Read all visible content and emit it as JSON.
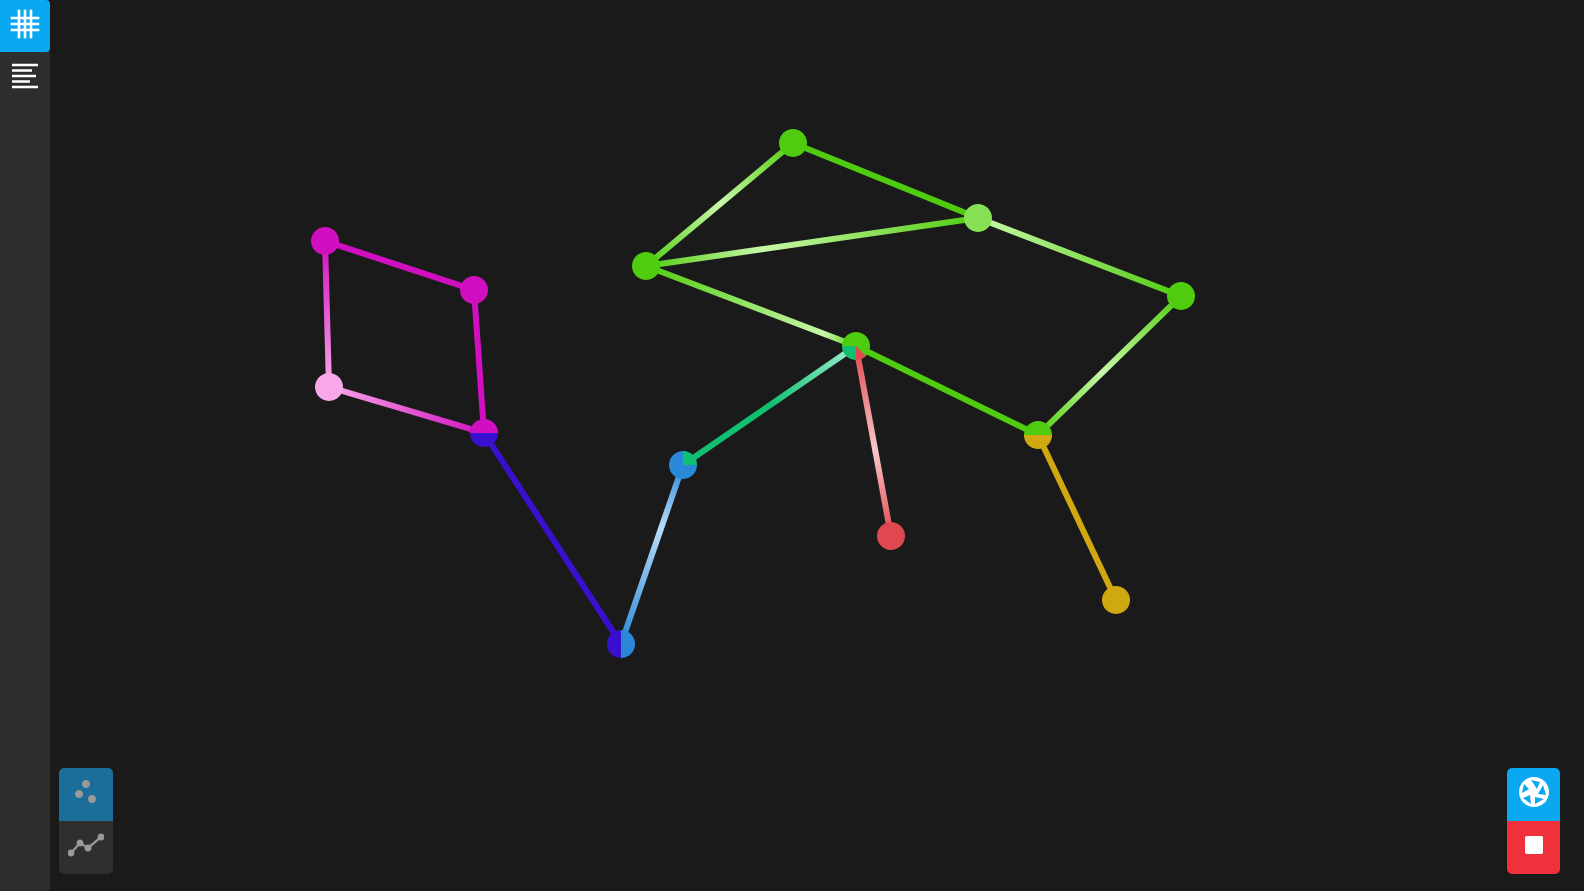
{
  "sidebar": {
    "items": [
      {
        "icon": "grid-icon",
        "active": true
      },
      {
        "icon": "align-left-icon",
        "active": false
      }
    ],
    "accent_color": "#0ba8f2"
  },
  "graph": {
    "skeletons": [
      {
        "color": "#d010c0",
        "light_color": "#f8a8e8"
      },
      {
        "color": "#3a10d0",
        "light_color": "#7a60f0"
      },
      {
        "color": "#2a88d8",
        "light_color": "#b8dcf8"
      },
      {
        "color": "#10c070",
        "light_color": "#a0f0d0"
      },
      {
        "color": "#50cc10",
        "light_color": "#c8f8a8"
      },
      {
        "color": "#e04850",
        "light_color": "#f8c8c8"
      },
      {
        "color": "#d0a810",
        "light_color": "#f0d870"
      }
    ]
  },
  "mode_toggle": {
    "items": [
      {
        "icon": "points-icon",
        "active": true
      },
      {
        "icon": "line-chart-icon",
        "active": false
      }
    ]
  },
  "capture": {
    "shutter_icon": "camera-shutter-icon",
    "stop_icon": "stop-icon",
    "shutter_color": "#0ba8f2",
    "stop_color": "#f0303a"
  }
}
